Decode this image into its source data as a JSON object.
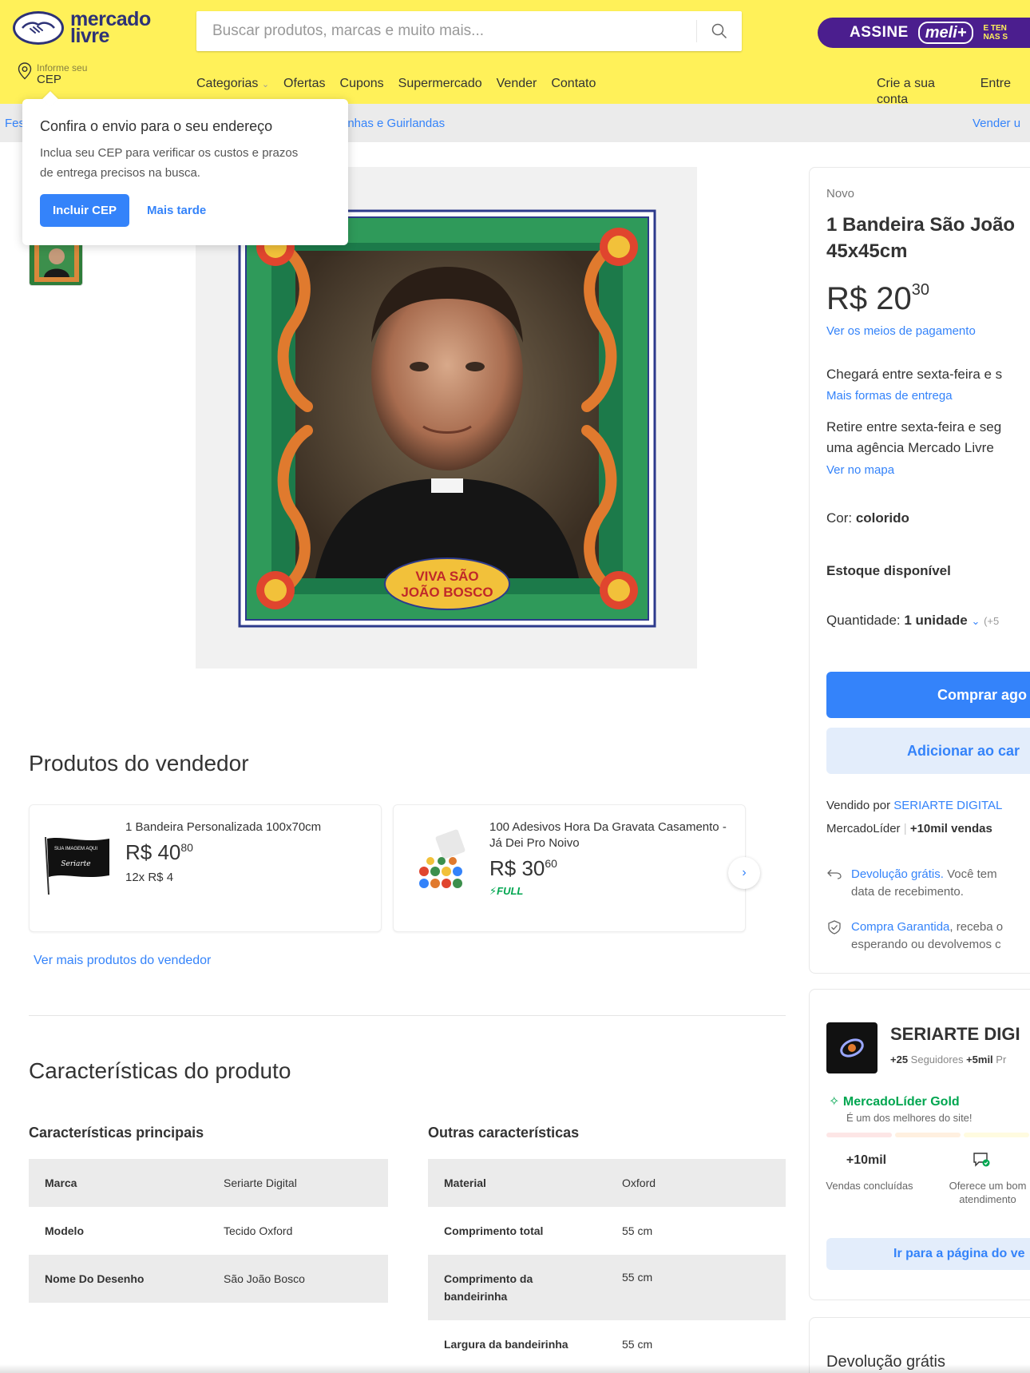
{
  "header": {
    "logo": {
      "line1": "mercado",
      "line2": "livre"
    },
    "search_placeholder": "Buscar produtos, marcas e muito mais...",
    "promo": {
      "label": "ASSINE",
      "brand": "meli+",
      "small_line1": "E TEN",
      "small_line2": "NAS S"
    },
    "cep": {
      "small": "Informe seu",
      "big": "CEP"
    },
    "nav": [
      "Categorias",
      "Ofertas",
      "Cupons",
      "Supermercado",
      "Vender",
      "Contato"
    ],
    "account": [
      "Crie a sua conta",
      "Entre"
    ]
  },
  "subbar": {
    "left": "Fes",
    "mid": "rinhas e Guirlandas",
    "right": "Vender u"
  },
  "popup": {
    "title": "Confira o envio para o seu endereço",
    "text": "Inclua seu CEP para verificar os custos e prazos de entrega precisos na busca.",
    "primary": "Incluir CEP",
    "secondary": "Mais tarde"
  },
  "product": {
    "condition": "Novo",
    "title": "1 Bandeira São João 45x45cm",
    "price_int": "R$ 20",
    "price_cents": "30",
    "payment_link": "Ver os meios de pagamento",
    "delivery": "Chegará entre sexta-feira e s",
    "delivery_link": "Mais formas de entrega",
    "pickup_line1": "Retire entre sexta-feira e seg",
    "pickup_line2": "uma agência Mercado Livre",
    "pickup_link": "Ver no mapa",
    "color_label": "Cor: ",
    "color_value": "colorido",
    "stock": "Estoque disponível",
    "qty_label": "Quantidade: ",
    "qty_value": "1 unidade",
    "qty_extra": "(+5",
    "buy_button": "Comprar ago",
    "cart_button": "Adicionar ao car",
    "sold_by_label": "Vendido por",
    "sold_by_name": "SERIARTE DIGITAL",
    "seller_badge": "MercadoLíder",
    "seller_sales": "+10mil vendas",
    "returns_link": "Devolução grátis.",
    "returns_text": " Você tem ",
    "returns_line2": "data de recebimento.",
    "guarantee_link": "Compra Garantida",
    "guarantee_text": ", receba o",
    "guarantee_line2": "esperando ou devolvemos c",
    "image_banner_line1": "VIVA SÃO",
    "image_banner_line2": "JOÃO BOSCO"
  },
  "seller_products": {
    "title": "Produtos do vendedor",
    "items": [
      {
        "name": "1 Bandeira Personalizada 100x70cm",
        "price_int": "R$ 40",
        "price_cents": "80",
        "installments": "12x R$ 4",
        "full": ""
      },
      {
        "name": "100 Adesivos Hora Da Gravata Casamento - Já Dei Pro Noivo",
        "price_int": "R$ 30",
        "price_cents": "60",
        "installments": "",
        "full": "FULL"
      }
    ],
    "more_link": "Ver mais produtos do vendedor",
    "flag_text1": "SUA IMAGEM AQUI",
    "flag_text2": "Seriarte"
  },
  "characteristics": {
    "title": "Características do produto",
    "main_title": "Características principais",
    "other_title": "Outras características",
    "main": [
      {
        "k": "Marca",
        "v": "Seriarte Digital"
      },
      {
        "k": "Modelo",
        "v": "Tecido Oxford"
      },
      {
        "k": "Nome Do Desenho",
        "v": "São João Bosco"
      }
    ],
    "other": [
      {
        "k": "Material",
        "v": "Oxford"
      },
      {
        "k": "Comprimento total",
        "v": "55 cm"
      },
      {
        "k": "Comprimento da bandeirinha",
        "v": "55 cm"
      },
      {
        "k": "Largura da bandeirinha",
        "v": "55 cm"
      }
    ]
  },
  "seller": {
    "name": "SERIARTE DIGI",
    "followers": "+25",
    "followers_label": " Seguidores ",
    "products": "+5mil",
    "products_label": " Pr",
    "gold": "MercadoLíder Gold",
    "gold_sub": "É um dos melhores do site!",
    "sales_value": "+10mil",
    "sales_label": "Vendas concluídas",
    "service_label": "Oferece um bom atendimento",
    "store_button": "Ir para a página do ve",
    "reputation_colors": [
      "#fde6e6",
      "#fff0e0",
      "#fffbe0",
      "#e6f7ea"
    ]
  },
  "returns_card": {
    "title": "Devolução grátis"
  },
  "colors": {
    "yellow": "#fff159",
    "blue": "#3483fa",
    "green": "#00a650",
    "purple": "#4b1e8e"
  }
}
